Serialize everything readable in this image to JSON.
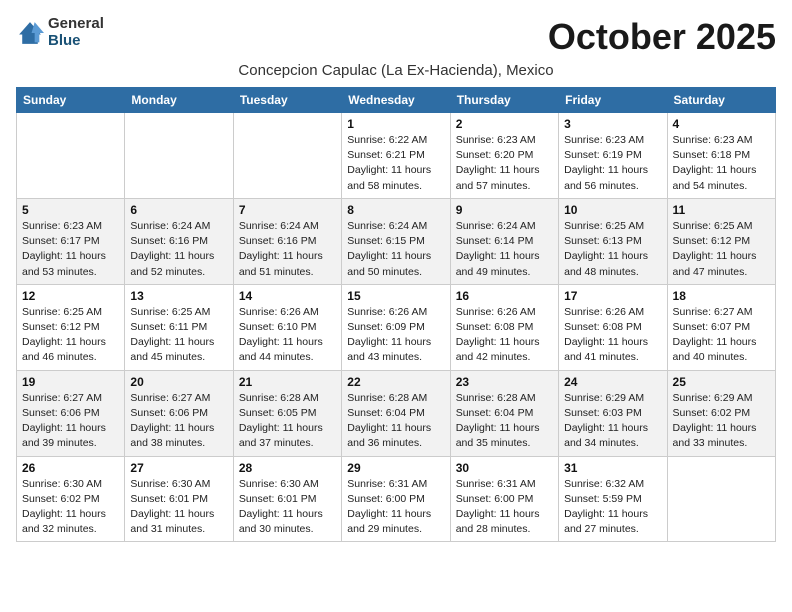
{
  "logo": {
    "general": "General",
    "blue": "Blue"
  },
  "title": "October 2025",
  "subtitle": "Concepcion Capulac (La Ex-Hacienda), Mexico",
  "days_of_week": [
    "Sunday",
    "Monday",
    "Tuesday",
    "Wednesday",
    "Thursday",
    "Friday",
    "Saturday"
  ],
  "weeks": [
    [
      {
        "day": "",
        "info": ""
      },
      {
        "day": "",
        "info": ""
      },
      {
        "day": "",
        "info": ""
      },
      {
        "day": "1",
        "info": "Sunrise: 6:22 AM\nSunset: 6:21 PM\nDaylight: 11 hours and 58 minutes."
      },
      {
        "day": "2",
        "info": "Sunrise: 6:23 AM\nSunset: 6:20 PM\nDaylight: 11 hours and 57 minutes."
      },
      {
        "day": "3",
        "info": "Sunrise: 6:23 AM\nSunset: 6:19 PM\nDaylight: 11 hours and 56 minutes."
      },
      {
        "day": "4",
        "info": "Sunrise: 6:23 AM\nSunset: 6:18 PM\nDaylight: 11 hours and 54 minutes."
      }
    ],
    [
      {
        "day": "5",
        "info": "Sunrise: 6:23 AM\nSunset: 6:17 PM\nDaylight: 11 hours and 53 minutes."
      },
      {
        "day": "6",
        "info": "Sunrise: 6:24 AM\nSunset: 6:16 PM\nDaylight: 11 hours and 52 minutes."
      },
      {
        "day": "7",
        "info": "Sunrise: 6:24 AM\nSunset: 6:16 PM\nDaylight: 11 hours and 51 minutes."
      },
      {
        "day": "8",
        "info": "Sunrise: 6:24 AM\nSunset: 6:15 PM\nDaylight: 11 hours and 50 minutes."
      },
      {
        "day": "9",
        "info": "Sunrise: 6:24 AM\nSunset: 6:14 PM\nDaylight: 11 hours and 49 minutes."
      },
      {
        "day": "10",
        "info": "Sunrise: 6:25 AM\nSunset: 6:13 PM\nDaylight: 11 hours and 48 minutes."
      },
      {
        "day": "11",
        "info": "Sunrise: 6:25 AM\nSunset: 6:12 PM\nDaylight: 11 hours and 47 minutes."
      }
    ],
    [
      {
        "day": "12",
        "info": "Sunrise: 6:25 AM\nSunset: 6:12 PM\nDaylight: 11 hours and 46 minutes."
      },
      {
        "day": "13",
        "info": "Sunrise: 6:25 AM\nSunset: 6:11 PM\nDaylight: 11 hours and 45 minutes."
      },
      {
        "day": "14",
        "info": "Sunrise: 6:26 AM\nSunset: 6:10 PM\nDaylight: 11 hours and 44 minutes."
      },
      {
        "day": "15",
        "info": "Sunrise: 6:26 AM\nSunset: 6:09 PM\nDaylight: 11 hours and 43 minutes."
      },
      {
        "day": "16",
        "info": "Sunrise: 6:26 AM\nSunset: 6:08 PM\nDaylight: 11 hours and 42 minutes."
      },
      {
        "day": "17",
        "info": "Sunrise: 6:26 AM\nSunset: 6:08 PM\nDaylight: 11 hours and 41 minutes."
      },
      {
        "day": "18",
        "info": "Sunrise: 6:27 AM\nSunset: 6:07 PM\nDaylight: 11 hours and 40 minutes."
      }
    ],
    [
      {
        "day": "19",
        "info": "Sunrise: 6:27 AM\nSunset: 6:06 PM\nDaylight: 11 hours and 39 minutes."
      },
      {
        "day": "20",
        "info": "Sunrise: 6:27 AM\nSunset: 6:06 PM\nDaylight: 11 hours and 38 minutes."
      },
      {
        "day": "21",
        "info": "Sunrise: 6:28 AM\nSunset: 6:05 PM\nDaylight: 11 hours and 37 minutes."
      },
      {
        "day": "22",
        "info": "Sunrise: 6:28 AM\nSunset: 6:04 PM\nDaylight: 11 hours and 36 minutes."
      },
      {
        "day": "23",
        "info": "Sunrise: 6:28 AM\nSunset: 6:04 PM\nDaylight: 11 hours and 35 minutes."
      },
      {
        "day": "24",
        "info": "Sunrise: 6:29 AM\nSunset: 6:03 PM\nDaylight: 11 hours and 34 minutes."
      },
      {
        "day": "25",
        "info": "Sunrise: 6:29 AM\nSunset: 6:02 PM\nDaylight: 11 hours and 33 minutes."
      }
    ],
    [
      {
        "day": "26",
        "info": "Sunrise: 6:30 AM\nSunset: 6:02 PM\nDaylight: 11 hours and 32 minutes."
      },
      {
        "day": "27",
        "info": "Sunrise: 6:30 AM\nSunset: 6:01 PM\nDaylight: 11 hours and 31 minutes."
      },
      {
        "day": "28",
        "info": "Sunrise: 6:30 AM\nSunset: 6:01 PM\nDaylight: 11 hours and 30 minutes."
      },
      {
        "day": "29",
        "info": "Sunrise: 6:31 AM\nSunset: 6:00 PM\nDaylight: 11 hours and 29 minutes."
      },
      {
        "day": "30",
        "info": "Sunrise: 6:31 AM\nSunset: 6:00 PM\nDaylight: 11 hours and 28 minutes."
      },
      {
        "day": "31",
        "info": "Sunrise: 6:32 AM\nSunset: 5:59 PM\nDaylight: 11 hours and 27 minutes."
      },
      {
        "day": "",
        "info": ""
      }
    ]
  ]
}
